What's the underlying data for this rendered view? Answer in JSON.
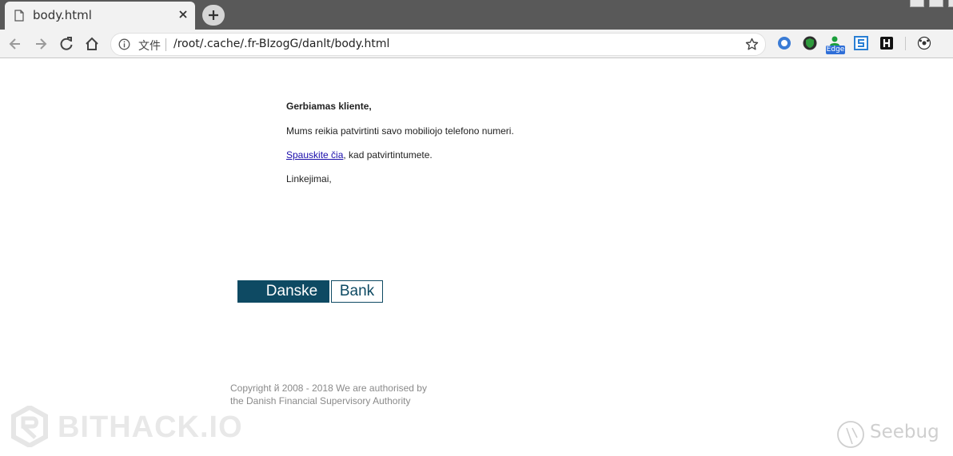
{
  "browser": {
    "tab": {
      "title": "body.html"
    },
    "address_bar": {
      "scheme_label": "文件",
      "url": "/root/.cache/.fr-BIzogG/danlt/body.html"
    },
    "extensions": [
      {
        "name": "circle-extension-icon"
      },
      {
        "name": "shield-extension-icon"
      },
      {
        "name": "edge-extension-icon",
        "badge": "Edge"
      },
      {
        "name": "s-extension-icon"
      },
      {
        "name": "h-extension-icon"
      },
      {
        "name": "soccer-extension-icon"
      }
    ]
  },
  "email": {
    "greeting": "Gerbiamas kliente,",
    "line1": "Mums reikia patvirtinti savo mobiliojo telefono numeri.",
    "link_text": "Spauskite čia",
    "line2_rest": ", kad patvirtintumete.",
    "closing": "Linkejimai,"
  },
  "logo": {
    "part1": "Danske",
    "part2": "Bank",
    "color": "#0e4a63"
  },
  "footer": {
    "copyright_line1": "Copyright й 2008 - 2018 We are authorised by",
    "copyright_line2": "the Danish Financial Supervisory Authority"
  },
  "watermarks": {
    "left": "BITHACK.IO",
    "right": "Seebug"
  }
}
